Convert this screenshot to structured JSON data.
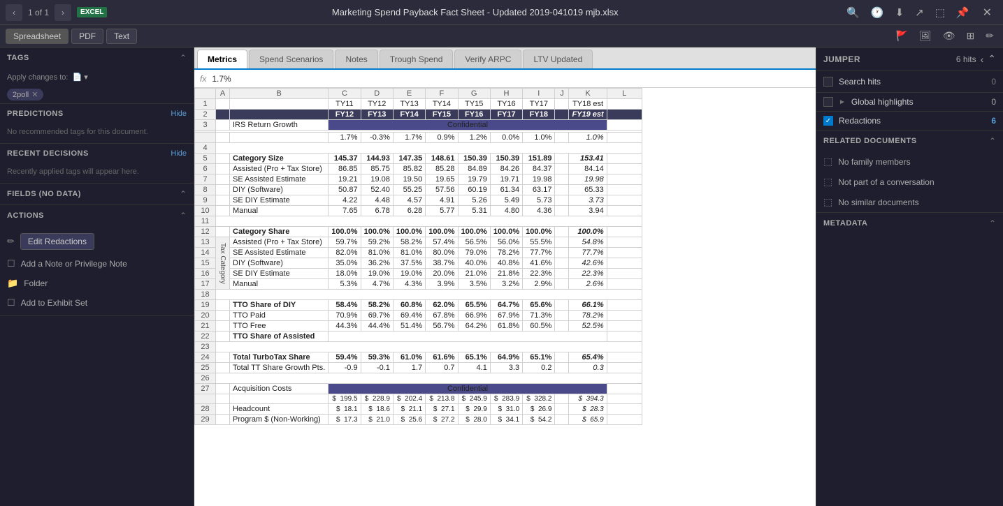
{
  "topbar": {
    "page_count": "1 of 1",
    "excel_badge": "EXCEL",
    "doc_title": "Marketing Spend Payback Fact Sheet - Updated 2019-041019 mjb.xlsx",
    "close": "✕"
  },
  "secondbar": {
    "spreadsheet": "Spreadsheet",
    "pdf": "PDF",
    "text": "Text"
  },
  "tabs": {
    "metrics": "Metrics",
    "spend_scenarios": "Spend Scenarios",
    "notes": "Notes",
    "trough_spend": "Trough Spend",
    "verify_arpc": "Verify ARPC",
    "ltv_updated": "LTV Updated"
  },
  "formula": {
    "icon": "fx",
    "value": "1.7%"
  },
  "left_sidebar": {
    "tags_title": "TAGS",
    "apply_label": "Apply changes to:",
    "tag": "2poll",
    "predictions_title": "PREDICTIONS",
    "hide": "Hide",
    "no_recommendations": "No recommended tags for this document.",
    "recent_decisions_title": "RECENT DECISIONS",
    "recently_applied": "Recently applied tags will appear here.",
    "fields_title": "FIELDS (No Data)",
    "actions_title": "ACTIONS",
    "edit_redactions": "Edit Redactions",
    "add_note": "Add a Note or Privilege Note",
    "folder": "Folder",
    "add_exhibit": "Add to Exhibit Set"
  },
  "right_panel": {
    "jumper_title": "JUMPER",
    "hits_label": "6 hits",
    "search_hits_label": "Search hits",
    "search_hits_count": "0",
    "global_highlights_label": "Global highlights",
    "global_highlights_count": "0",
    "redactions_label": "Redactions",
    "redactions_count": "6",
    "related_docs_title": "RELATED DOCUMENTS",
    "no_family": "No family members",
    "no_conversation": "Not part of a conversation",
    "no_similar": "No similar documents",
    "metadata_title": "METADATA"
  },
  "grid": {
    "col_headers": [
      "",
      "A",
      "B",
      "C",
      "D",
      "E",
      "F",
      "G",
      "H",
      "I",
      "J",
      "K",
      "L"
    ],
    "row1": {
      "C": "TY11",
      "D": "TY12",
      "E": "TY13",
      "F": "TY14",
      "G": "TY15",
      "H": "TY16",
      "I": "TY17",
      "K": "TY18 est"
    },
    "row2": {
      "C": "FY12",
      "D": "FY13",
      "E": "FY14",
      "F": "FY15",
      "G": "FY16",
      "H": "FY17",
      "I": "FY18",
      "K": "FY19 est"
    },
    "confidential": "Confidential",
    "tax_category": "Tax Category"
  },
  "colors": {
    "accent": "#007acc",
    "excel_green": "#217346",
    "confidential_bg": "#4a4a8a",
    "dark_header": "#3a3a5a",
    "sidebar_bg": "#1e1e2e",
    "grid_bg": "#fff",
    "redactions_color": "#5b9bd5"
  }
}
